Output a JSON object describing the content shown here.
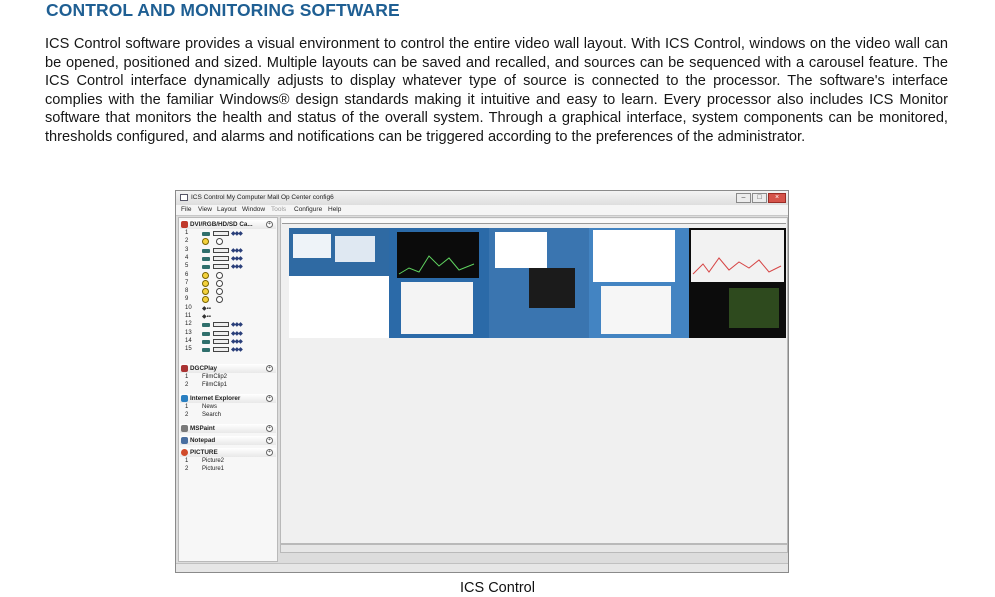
{
  "heading": "CONTROL AND MONITORING SOFTWARE",
  "paragraph": "ICS Control software provides a visual environment to control the entire video wall layout. With  ICS Control, windows on the video wall can be opened, positioned and sized. Multiple layouts can be saved and recalled, and sources can be sequenced with a carousel feature. The ICS Control interface dynamically adjusts to display whatever type of source is connected to the processor. The software's interface complies with the familiar Windows® design standards making it intuitive and easy to learn. Every processor also includes ICS Monitor software that monitors the health and status of the overall system. Through a graphical interface, system components can be monitored, thresholds configured, and alarms and notifications can be triggered according to the preferences of the administrator.",
  "caption": "ICS Control",
  "screenshot": {
    "window_title": "ICS Control   My Computer   Mall Op Center config6",
    "menu": [
      "File",
      "View",
      "Layout",
      "Window",
      "Tools",
      "Configure",
      "Help"
    ],
    "groups": [
      {
        "label": "DVI/RGB/HD/SD Ca...",
        "color": "#c0392b"
      },
      {
        "label": "DGCPlay",
        "color": "#a33"
      },
      {
        "label": "Internet Explorer",
        "color": "#2a7fc1"
      },
      {
        "label": "MSPaint",
        "color": "#7a7a7a"
      },
      {
        "label": "Notepad",
        "color": "#4a6fa0"
      },
      {
        "label": "PICTURE",
        "color": "#d04a2a"
      }
    ],
    "inputs": [
      "1",
      "2",
      "3",
      "4",
      "5",
      "6",
      "7",
      "8",
      "9",
      "10",
      "11",
      "12",
      "13",
      "14",
      "15"
    ],
    "dgcplay_items": [
      {
        "num": "1",
        "label": "FilmClip2"
      },
      {
        "num": "2",
        "label": "FilmClip1"
      }
    ],
    "ie_items": [
      {
        "num": "1",
        "label": "News"
      },
      {
        "num": "2",
        "label": "Search"
      }
    ],
    "picture_items": [
      {
        "num": "1",
        "label": "Picture2"
      },
      {
        "num": "2",
        "label": "Picture1"
      }
    ],
    "colors": {
      "heading": "#1f5f93",
      "wall_background": "#1d3b5e",
      "close_button": "#d5534a"
    }
  }
}
